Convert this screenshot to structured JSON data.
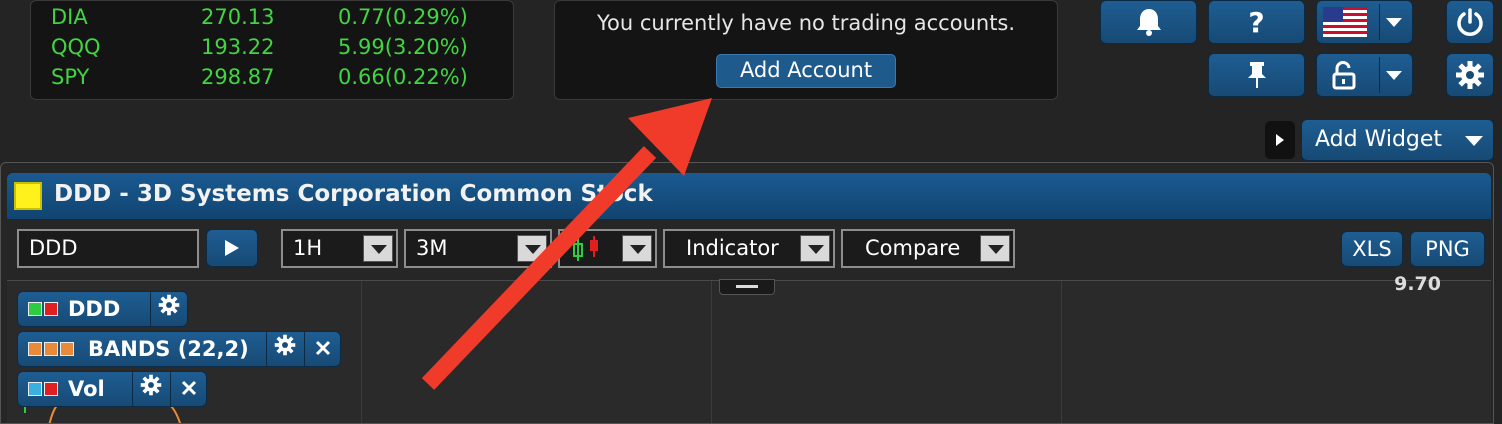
{
  "ticker": {
    "rows": [
      {
        "symbol": "DIA",
        "price": "270.13",
        "change": "0.77(0.29%)"
      },
      {
        "symbol": "QQQ",
        "price": "193.22",
        "change": "5.99(3.20%)"
      },
      {
        "symbol": "SPY",
        "price": "298.87",
        "change": "0.66(0.22%)"
      }
    ]
  },
  "accounts": {
    "message": "You currently have no trading accounts.",
    "add_label": "Add Account"
  },
  "toolbar": {
    "icons": [
      "bell-icon",
      "help-icon",
      "us-flag-icon",
      "power-icon",
      "pin-icon",
      "unlock-icon",
      "gear-icon"
    ],
    "help_label": "?"
  },
  "widgets": {
    "add_label": "Add Widget"
  },
  "chart_widget": {
    "title": "DDD - 3D Systems Corporation Common Stock",
    "symbol_value": "DDD",
    "interval": "1H",
    "range": "3M",
    "indicator_label": "Indicator",
    "compare_label": "Compare",
    "xls_label": "XLS",
    "png_label": "PNG",
    "price_axis_label": "9.70",
    "studies": [
      {
        "label": "DDD",
        "colors": [
          "#2ecc40",
          "#e02020"
        ]
      },
      {
        "label": "BANDS (22,2)",
        "colors": [
          "#e88a3a",
          "#e88a3a",
          "#e88a3a"
        ]
      },
      {
        "label": "Vol",
        "colors": [
          "#3ab0e0",
          "#e02020"
        ]
      }
    ],
    "accent_color": "#fff21c"
  },
  "annotation": {
    "arrow_color": "#f03a2a"
  }
}
